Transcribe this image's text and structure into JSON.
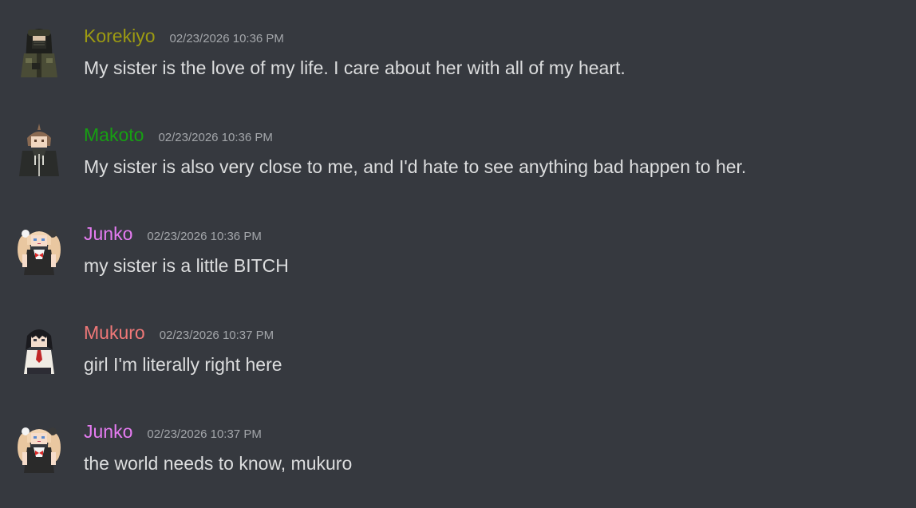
{
  "messages": [
    {
      "username": "Korekiyo",
      "timestamp": "02/23/2026 10:36 PM",
      "content": "My sister is the love of my life. I care about her with all of my heart.",
      "name_color": "#9c9a12",
      "avatar_icon": "korekiyo-avatar-icon"
    },
    {
      "username": "Makoto",
      "timestamp": "02/23/2026 10:36 PM",
      "content": "My sister is also very close to me, and I'd hate to see anything bad happen to her.",
      "name_color": "#16a012",
      "avatar_icon": "makoto-avatar-icon"
    },
    {
      "username": "Junko",
      "timestamp": "02/23/2026 10:36 PM",
      "content": "my sister is a little BITCH",
      "name_color": "#e67cf2",
      "avatar_icon": "junko-avatar-icon"
    },
    {
      "username": "Mukuro",
      "timestamp": "02/23/2026 10:37 PM",
      "content": "girl I'm literally right here",
      "name_color": "#f07878",
      "avatar_icon": "mukuro-avatar-icon"
    },
    {
      "username": "Junko",
      "timestamp": "02/23/2026 10:37 PM",
      "content": "the world needs to know, mukuro",
      "name_color": "#e67cf2",
      "avatar_icon": "junko-avatar-icon"
    }
  ],
  "colors": {
    "background": "#36393f",
    "message_text": "#dcddde",
    "timestamp_text": "#a3a6aa"
  }
}
